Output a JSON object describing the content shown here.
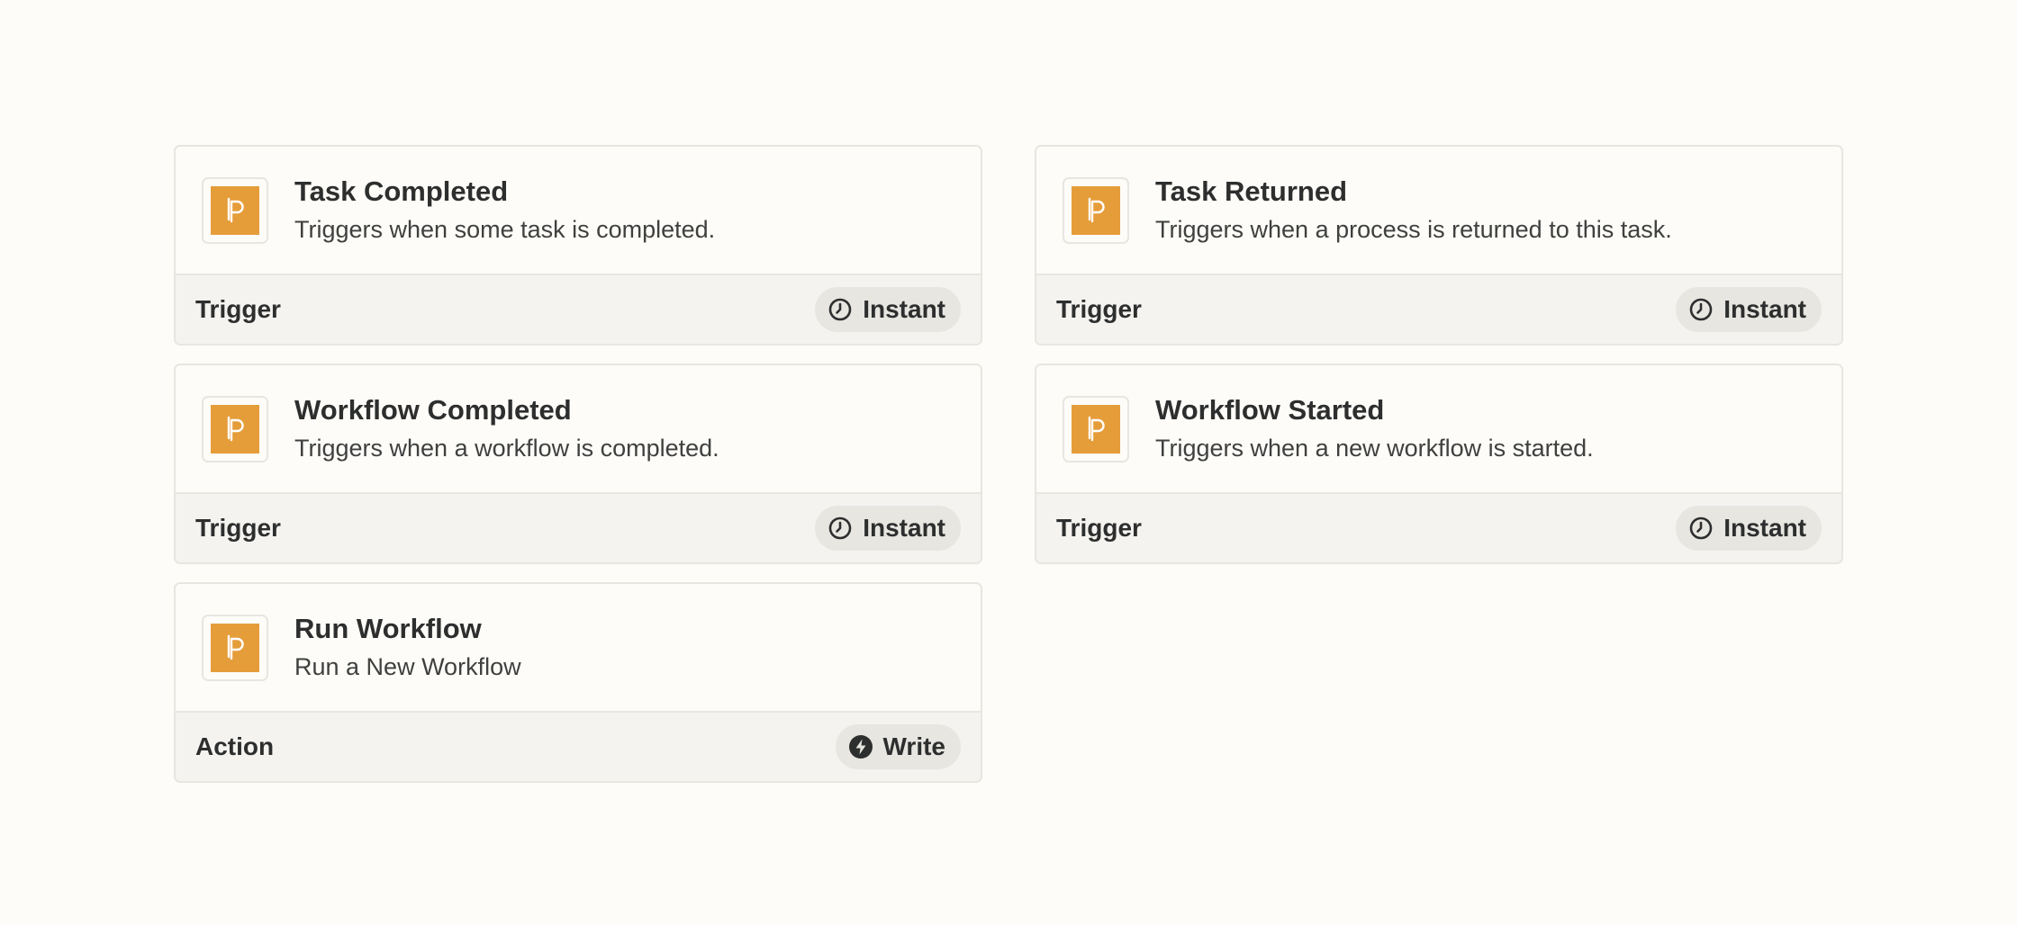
{
  "colors": {
    "background": "#fdfcf8",
    "brand_orange": "#e59d3a",
    "footer_bg": "#f4f3f0",
    "pill_bg": "#e7e6e1",
    "border": "#e7e6e1",
    "text": "#2d2e2e"
  },
  "app_icon": "process-street-logo-icon",
  "cards": [
    {
      "title": "Task Completed",
      "description": "Triggers when some task is completed.",
      "type_label": "Trigger",
      "badge_label": "Instant",
      "badge_icon": "clock-icon"
    },
    {
      "title": "Task Returned",
      "description": "Triggers when a process is returned to this task.",
      "type_label": "Trigger",
      "badge_label": "Instant",
      "badge_icon": "clock-icon"
    },
    {
      "title": "Workflow Completed",
      "description": "Triggers when a workflow is completed.",
      "type_label": "Trigger",
      "badge_label": "Instant",
      "badge_icon": "clock-icon"
    },
    {
      "title": "Workflow Started",
      "description": "Triggers when a new workflow is started.",
      "type_label": "Trigger",
      "badge_label": "Instant",
      "badge_icon": "clock-icon"
    },
    {
      "title": "Run Workflow",
      "description": "Run a New Workflow",
      "type_label": "Action",
      "badge_label": "Write",
      "badge_icon": "lightning-bolt-icon"
    }
  ]
}
